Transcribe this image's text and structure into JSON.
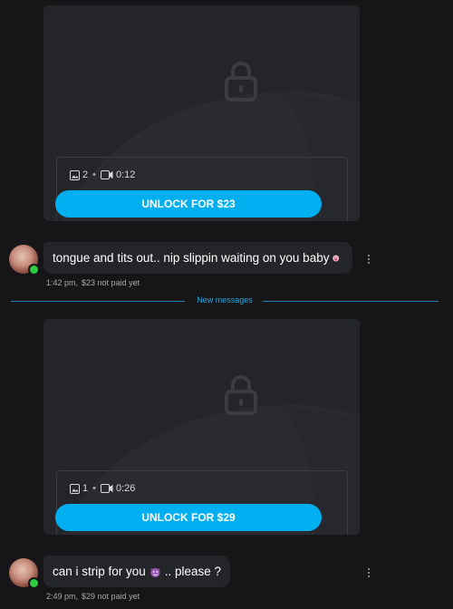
{
  "posts": [
    {
      "media": {
        "photos": "2",
        "video_duration": "0:12"
      },
      "unlock_label": "UNLOCK FOR $23",
      "message_text": "tongue and tits out.. nip slippin waiting on you baby",
      "message_emoji": "tongue-emoji",
      "time": "1:42 pm,",
      "price_status": "$23 not paid yet"
    },
    {
      "media": {
        "photos": "1",
        "video_duration": "0:26"
      },
      "unlock_label": "UNLOCK FOR $29",
      "message_text_before": "can i strip for you",
      "message_emoji": "devil-emoji",
      "message_text_after": ".. please ?",
      "time": "2:49 pm,",
      "price_status": "$29 not paid yet"
    }
  ],
  "divider": {
    "label": "New messages"
  },
  "colors": {
    "background": "#161618",
    "card": "#242529",
    "accent": "#00aff0",
    "divider": "#1e7fb0",
    "online": "#2ecc40"
  },
  "icons": [
    "lock-icon",
    "image-icon",
    "video-icon",
    "more-vertical-icon",
    "avatar"
  ]
}
